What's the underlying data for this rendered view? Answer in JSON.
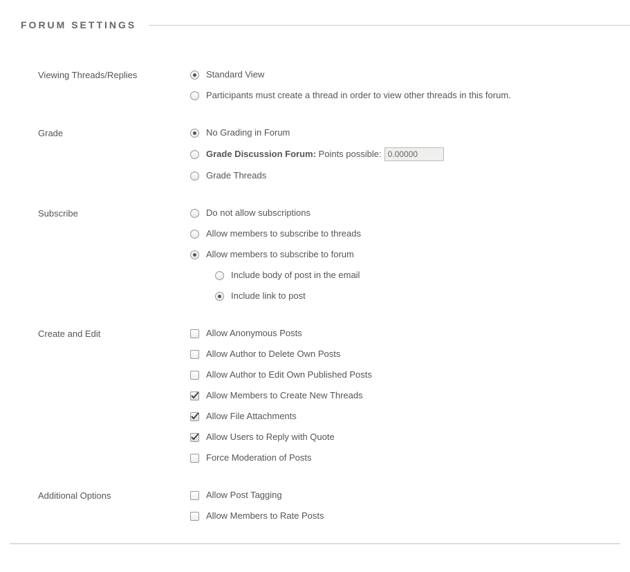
{
  "section_title": "FORUM SETTINGS",
  "rows": {
    "viewing": {
      "label": "Viewing Threads/Replies",
      "options": [
        "Standard View",
        "Participants must create a thread in order to view other threads in this forum."
      ]
    },
    "grade": {
      "label": "Grade",
      "options": {
        "no_grading": "No Grading in Forum",
        "grade_forum_bold": "Grade Discussion Forum:",
        "points_label": "Points possible:",
        "points_value": "0.00000",
        "grade_threads": "Grade Threads"
      }
    },
    "subscribe": {
      "label": "Subscribe",
      "options": [
        "Do not allow subscriptions",
        "Allow members to subscribe to threads",
        "Allow members to subscribe to forum"
      ],
      "nested": [
        "Include body of post in the email",
        "Include link to post"
      ]
    },
    "create_edit": {
      "label": "Create and Edit",
      "options": [
        "Allow Anonymous Posts",
        "Allow Author to Delete Own Posts",
        "Allow Author to Edit Own Published Posts",
        "Allow Members to Create New Threads",
        "Allow File Attachments",
        "Allow Users to Reply with Quote",
        "Force Moderation of Posts"
      ]
    },
    "additional": {
      "label": "Additional Options",
      "options": [
        "Allow Post Tagging",
        "Allow Members to Rate Posts"
      ]
    }
  }
}
